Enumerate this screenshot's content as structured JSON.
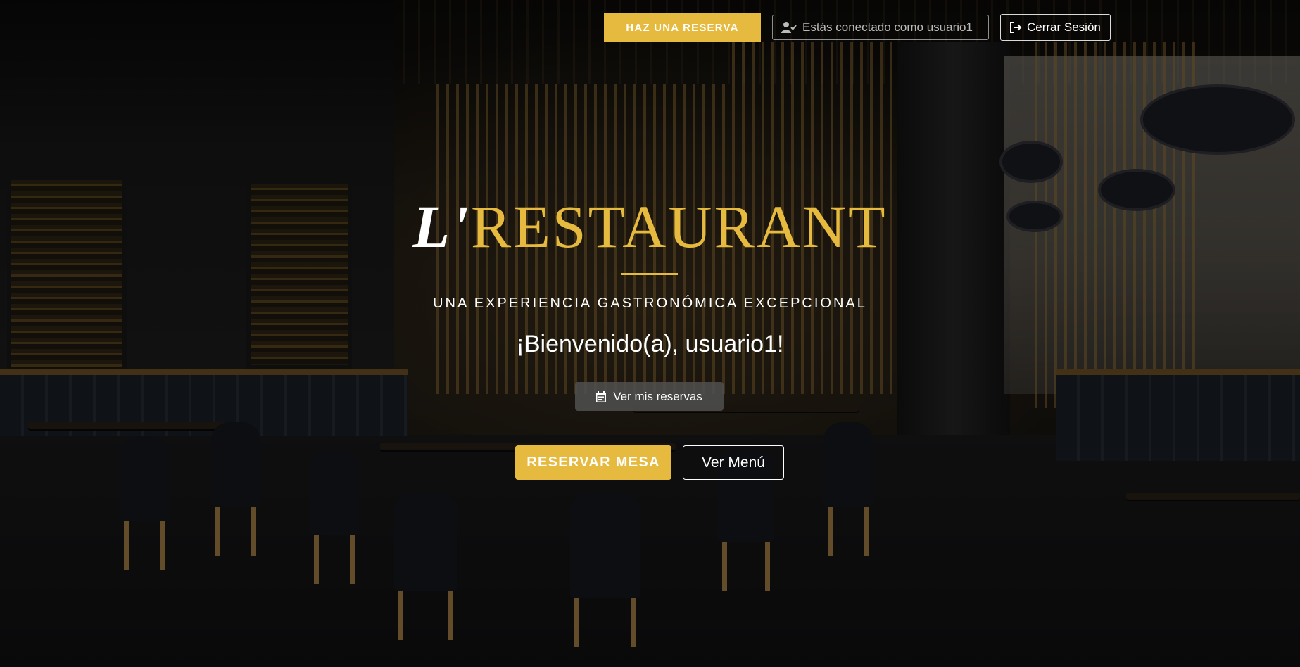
{
  "header": {
    "reserve_button": "HAZ UNA RESERVA",
    "user_status": "Estás conectado como usuario1",
    "logout_button": "Cerrar Sesión",
    "user_icon": "user-check-icon",
    "logout_icon": "sign-out-icon"
  },
  "hero": {
    "brand_prefix": "L'",
    "brand_name": "RESTAURANT",
    "tagline": "UNA EXPERIENCIA GASTRONÓMICA EXCEPCIONAL",
    "welcome": "¡Bienvenido(a), usuario1!",
    "my_reservations_button": "Ver mis reservas",
    "my_reservations_icon": "calendar-icon",
    "reserve_table_button": "RESERVAR MESA",
    "menu_button": "Ver Menú"
  },
  "colors": {
    "accent": "#e6b93f",
    "overlay": "#000000",
    "text": "#ffffff"
  }
}
